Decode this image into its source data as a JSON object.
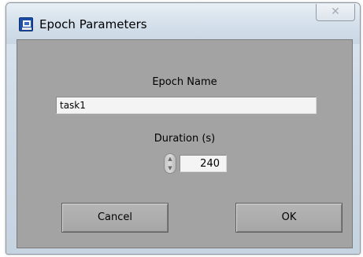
{
  "window": {
    "title": "Epoch Parameters",
    "close_glyph": "✕"
  },
  "epoch": {
    "name_label": "Epoch Name",
    "name_value": "task1",
    "duration_label": "Duration (s)",
    "duration_value": "240"
  },
  "buttons": {
    "cancel_label": "Cancel",
    "ok_label": "OK"
  },
  "colors": {
    "panel": "#a3a3a3",
    "title_icon": "#1d4fa8"
  }
}
